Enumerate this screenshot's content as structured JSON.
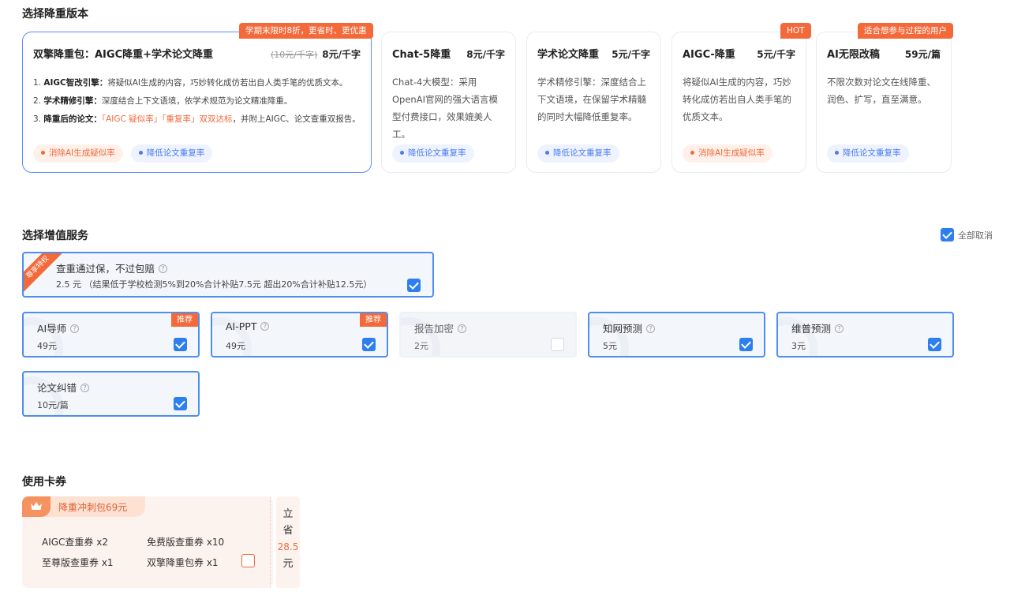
{
  "sections": {
    "version_title": "选择降重版本",
    "service_title": "选择增值服务",
    "coupon_title": "使用卡券"
  },
  "versions": [
    {
      "ribbon": "学期末限时8折，更省时、更优惠",
      "name": "双擎降重包：AIGC降重+学术论文降重",
      "old_price": "(10元/千字)",
      "price": "8元/千字",
      "lines": [
        {
          "num": "1.",
          "bold": "AIGC智改引擎：",
          "text": "将疑似AI生成的内容，巧妙转化成仿若出自人类手笔的优质文本。"
        },
        {
          "num": "2.",
          "bold": "学术精修引擎：",
          "text": "深度结合上下文语境，依学术规范为论文精准降重。"
        },
        {
          "num": "3.",
          "bold": "降重后的论文：",
          "hl": "「AIGC 疑似率」「重复率」双双达标",
          "text": "，并附上AIGC、论文查重双报告。"
        }
      ],
      "tags": [
        "消除AI生成疑似率",
        "降低论文重复率"
      ]
    },
    {
      "name": "Chat-5降重",
      "price": "8元/千字",
      "desc": "Chat-4大模型：采用OpenAI官网的强大语言模型付费接口，效果媲美人工。",
      "tags": [
        "降低论文重复率"
      ]
    },
    {
      "name": "学术论文降重",
      "price": "5元/千字",
      "desc": "学术精修引擎：深度结合上下文语境，在保留学术精髓的同时大幅降低重复率。",
      "tags": [
        "降低论文重复率"
      ]
    },
    {
      "ribbon": "HOT",
      "name": "AIGC-降重",
      "price": "5元/千字",
      "desc": "将疑似AI生成的内容，巧妙转化成仿若出自人类手笔的优质文本。",
      "tags": [
        "消除AI生成疑似率"
      ]
    },
    {
      "ribbon": "适合想参与过程的用户",
      "name": "AI无限改稿",
      "price": "59元/篇",
      "desc": "不限次数对论文在线降重、润色、扩写，直至满意。",
      "tags": [
        "降低论文重复率"
      ]
    }
  ],
  "select_all_label": "全部取消",
  "guarantee": {
    "corner": "尊享特权",
    "title": "查重通过保，不过包赔",
    "price": "2.5 元",
    "note": "（结果低于学校检测5%到20%合计补贴7.5元 超出20%合计补贴12.5元）",
    "checked": true
  },
  "services": [
    {
      "title": "AI导师",
      "price": "49元",
      "badge": "推荐",
      "checked": true
    },
    {
      "title": "AI-PPT",
      "price": "49元",
      "badge": "推荐",
      "checked": true
    },
    {
      "title": "报告加密",
      "price": "2元",
      "checked": false
    },
    {
      "title": "知网预测",
      "price": "5元",
      "checked": true
    },
    {
      "title": "维普预测",
      "price": "3元",
      "checked": true
    },
    {
      "title": "论文纠错",
      "price": "10元/篇",
      "checked": true
    }
  ],
  "coupon": {
    "label": "降重冲刺包69元",
    "items": [
      "AIGC查重券 x2",
      "免费版查重券 x10",
      "至尊版查重券 x1",
      "双擎降重包券 x1"
    ],
    "save_chars": [
      "立",
      "省"
    ],
    "save_amount": "28.5",
    "save_unit": "元",
    "checked": false
  },
  "colors": {
    "accent": "#2d7ff0",
    "orange": "#f4693a"
  }
}
